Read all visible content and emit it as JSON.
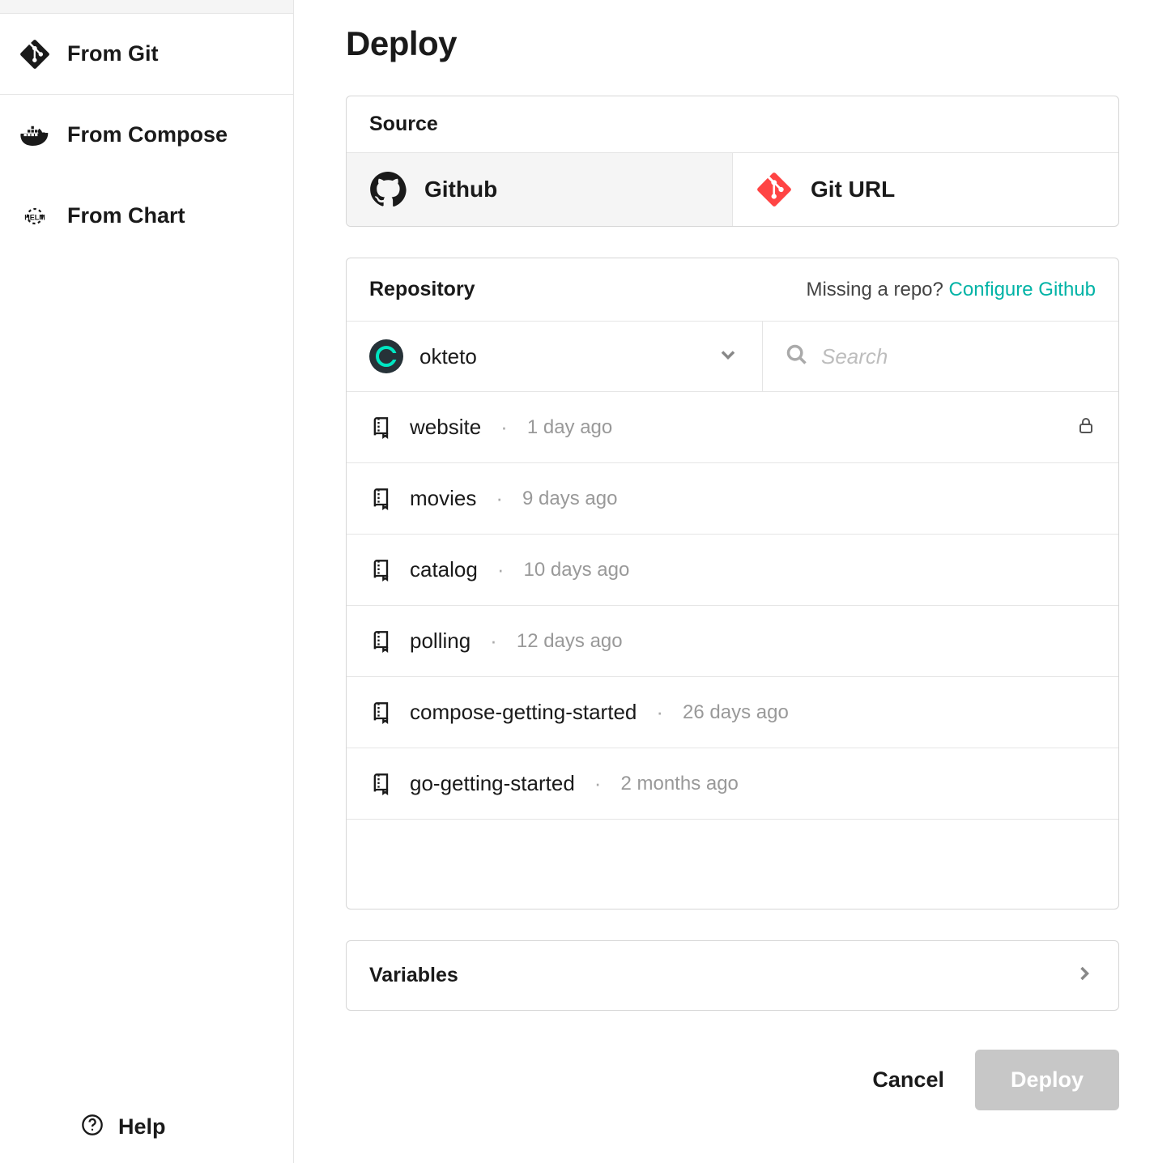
{
  "sidebar": {
    "items": [
      {
        "label": "From Git",
        "icon": "git-icon",
        "active": true
      },
      {
        "label": "From Compose",
        "icon": "docker-icon",
        "active": false
      },
      {
        "label": "From Chart",
        "icon": "helm-icon",
        "active": false
      }
    ],
    "help_label": "Help"
  },
  "page": {
    "title": "Deploy"
  },
  "source": {
    "header": "Source",
    "tabs": [
      {
        "label": "Github",
        "icon": "github-icon",
        "active": true
      },
      {
        "label": "Git URL",
        "icon": "git-url-icon",
        "active": false
      }
    ]
  },
  "repository": {
    "header": "Repository",
    "missing_prefix": "Missing a repo? ",
    "missing_link": "Configure Github",
    "org": {
      "name": "okteto"
    },
    "search": {
      "placeholder": "Search",
      "value": ""
    },
    "items": [
      {
        "name": "website",
        "time": "1 day ago",
        "private": true
      },
      {
        "name": "movies",
        "time": "9 days ago",
        "private": false
      },
      {
        "name": "catalog",
        "time": "10 days ago",
        "private": false
      },
      {
        "name": "polling",
        "time": "12 days ago",
        "private": false
      },
      {
        "name": "compose-getting-started",
        "time": "26 days ago",
        "private": false
      },
      {
        "name": "go-getting-started",
        "time": "2 months ago",
        "private": false
      }
    ]
  },
  "variables": {
    "label": "Variables"
  },
  "footer": {
    "cancel_label": "Cancel",
    "deploy_label": "Deploy"
  },
  "colors": {
    "accent": "#00b3a6"
  }
}
